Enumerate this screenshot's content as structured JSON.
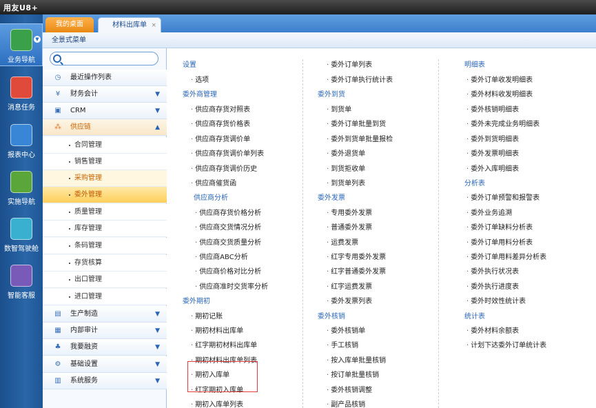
{
  "app": {
    "title": "用友U8+"
  },
  "left_nav": {
    "items": [
      {
        "label": "业务导航",
        "icon": "business-navigation-icon",
        "color": "#3aa04a"
      },
      {
        "label": "消息任务",
        "icon": "message-task-icon",
        "color": "#e04a3a"
      },
      {
        "label": "报表中心",
        "icon": "report-center-icon",
        "color": "#3a86d6"
      },
      {
        "label": "实施导航",
        "icon": "implementation-navigation-icon",
        "color": "#5aa63a"
      },
      {
        "label": "数智驾驶舱",
        "icon": "cockpit-icon",
        "color": "#3ab0d0"
      },
      {
        "label": "智能客服",
        "icon": "smart-service-icon",
        "color": "#7a5ab8"
      }
    ]
  },
  "tabs": [
    {
      "label": "我的桌面"
    },
    {
      "label": "材料出库单",
      "close": "×"
    }
  ],
  "menu_header": "全景式菜单",
  "search": {
    "placeholder": "",
    "value": ""
  },
  "tree": {
    "recent": "最近操作列表",
    "finance": "财务会计",
    "crm": "CRM",
    "supply_chain": "供应链",
    "sub": [
      "合同管理",
      "销售管理",
      "采购管理",
      "委外管理",
      "质量管理",
      "库存管理",
      "条码管理",
      "存货核算",
      "出口管理",
      "进口管理"
    ],
    "production": "生产制造",
    "audit": "内部审计",
    "finance_support": "我要融资",
    "base_settings": "基础设置",
    "system_service": "系统服务"
  },
  "content": {
    "col1": {
      "settings_header": "设置",
      "settings": [
        "选项"
      ],
      "supplier_header": "委外商管理",
      "supplier": [
        "供应商存货对照表",
        "供应商存货价格表",
        "供应商存货调价单",
        "供应商存货调价单列表",
        "供应商存货调价历史",
        "供应商催货函"
      ],
      "supplier_analysis_header": "供应商分析",
      "supplier_analysis": [
        "供应商存货价格分析",
        "供应商交货情况分析",
        "供应商交货质量分析",
        "供应商ABC分析",
        "供应商价格对比分析",
        "供应商准时交货率分析"
      ],
      "opening_header": "委外期初",
      "opening": [
        "期初记账",
        "期初材料出库单",
        "红字期初材料出库单",
        "期初材料出库单列表",
        "期初入库单",
        "红字期初入库单",
        "期初入库单列表"
      ]
    },
    "col2": {
      "top": [
        "委外订单列表",
        "委外订单执行统计表"
      ],
      "arrival_header": "委外到货",
      "arrival": [
        "到货单",
        "委外订单批量到货",
        "委外到货单批量报检",
        "委外退货单",
        "到货拒收单",
        "到货单列表"
      ],
      "invoice_header": "委外发票",
      "invoice": [
        "专用委外发票",
        "普通委外发票",
        "运费发票",
        "红字专用委外发票",
        "红字普通委外发票",
        "红字运费发票",
        "委外发票列表"
      ],
      "verify_header": "委外核销",
      "verify": [
        "委外核销单",
        "手工核销",
        "按入库单批量核销",
        "按订单批量核销",
        "委外核销调整",
        "副产品核销"
      ]
    },
    "col3": {
      "detail_header": "明细表",
      "detail": [
        "委外订单收发明细表",
        "委外材料收发明细表",
        "委外核销明细表",
        "委外未完成业务明细表",
        "委外到货明细表",
        "委外发票明细表",
        "委外入库明细表"
      ],
      "analysis_header": "分析表",
      "analysis": [
        "委外订单预警和报警表",
        "委外业务追溯",
        "委外订单缺料分析表",
        "委外订单用料分析表",
        "委外订单用料差异分析表",
        "委外执行状况表",
        "委外执行进度表",
        "委外时效性统计表"
      ],
      "stat_header": "统计表",
      "stat": [
        "委外材料余额表",
        "计划下达委外订单统计表"
      ]
    }
  },
  "colors": {
    "link_header": "#2a66b8",
    "highlight_box": "#e23b3b",
    "selected_bg": "#ffcf5a"
  }
}
